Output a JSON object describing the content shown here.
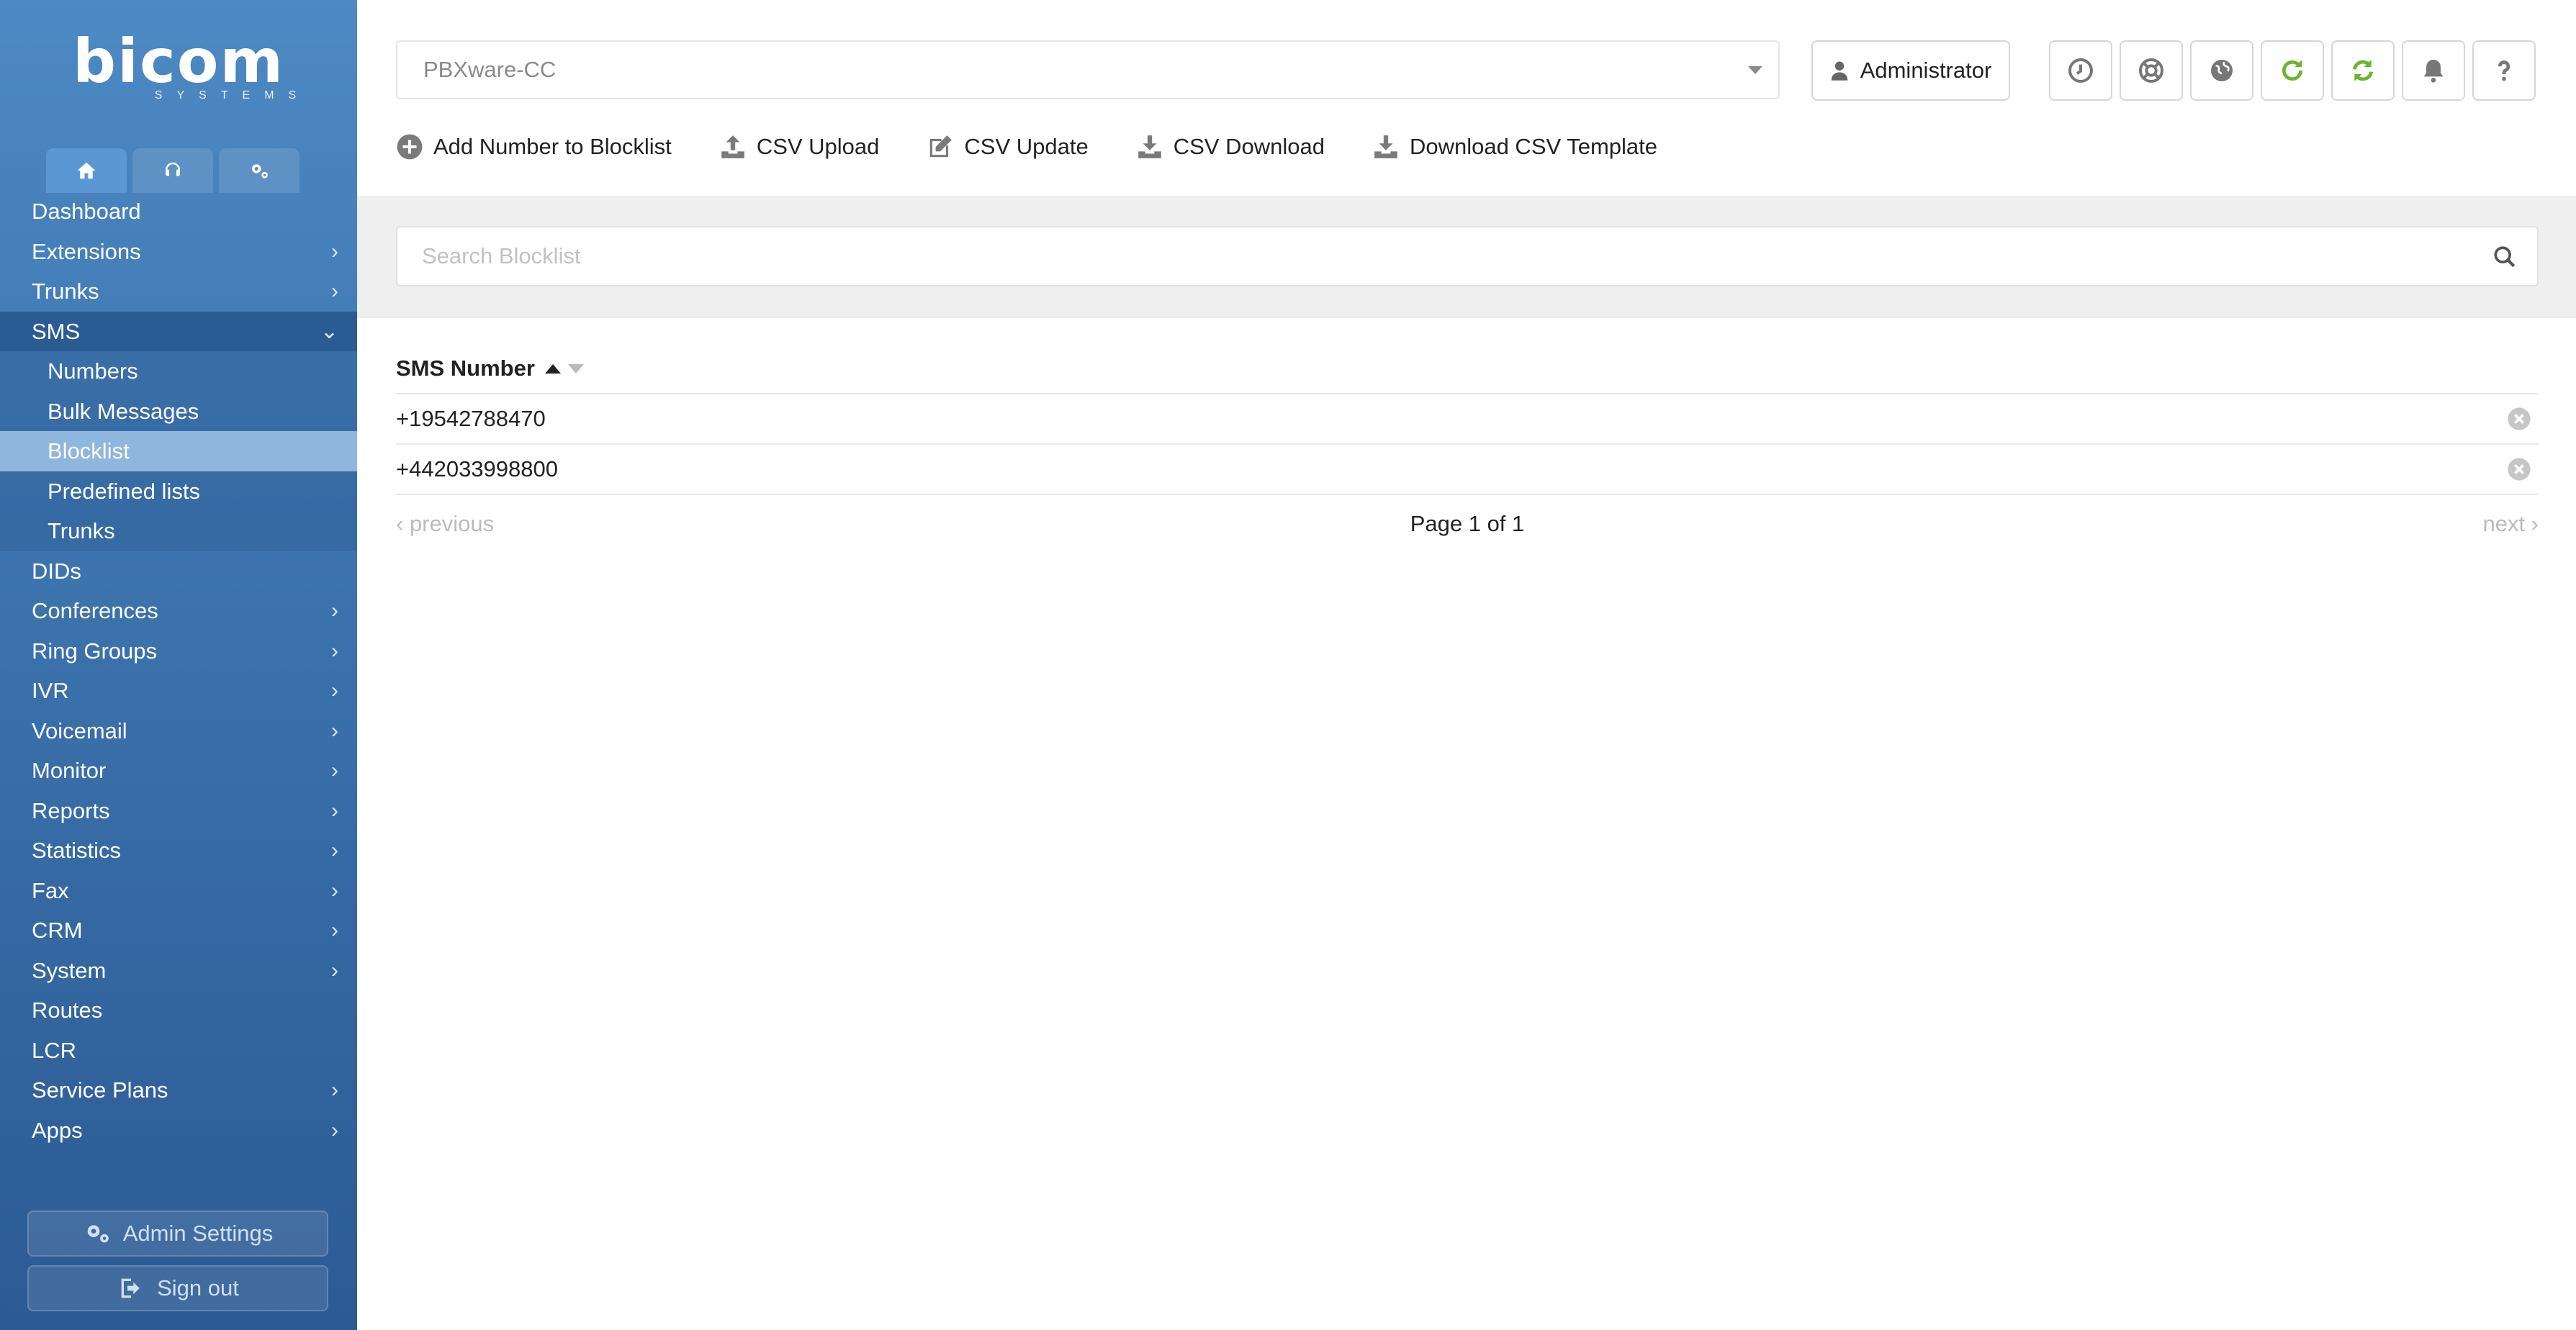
{
  "brand": {
    "logo_main": "bicom",
    "logo_sub": "SYSTEMS"
  },
  "sidebar": {
    "tabs": [
      {
        "icon": "home-icon"
      },
      {
        "icon": "headset-icon"
      },
      {
        "icon": "gears-icon"
      }
    ],
    "items": [
      {
        "label": "Dashboard",
        "chevron": ""
      },
      {
        "label": "Extensions",
        "chevron": "›"
      },
      {
        "label": "Trunks",
        "chevron": "›"
      },
      {
        "label": "SMS",
        "chevron": "⌄"
      },
      {
        "label": "Numbers"
      },
      {
        "label": "Bulk Messages"
      },
      {
        "label": "Blocklist"
      },
      {
        "label": "Predefined lists"
      },
      {
        "label": "Trunks"
      },
      {
        "label": "DIDs",
        "chevron": ""
      },
      {
        "label": "Conferences",
        "chevron": "›"
      },
      {
        "label": "Ring Groups",
        "chevron": "›"
      },
      {
        "label": "IVR",
        "chevron": "›"
      },
      {
        "label": "Voicemail",
        "chevron": "›"
      },
      {
        "label": "Monitor",
        "chevron": "›"
      },
      {
        "label": "Reports",
        "chevron": "›"
      },
      {
        "label": "Statistics",
        "chevron": "›"
      },
      {
        "label": "Fax",
        "chevron": "›"
      },
      {
        "label": "CRM",
        "chevron": "›"
      },
      {
        "label": "System",
        "chevron": "›"
      },
      {
        "label": "Routes",
        "chevron": ""
      },
      {
        "label": "LCR",
        "chevron": ""
      },
      {
        "label": "Service Plans",
        "chevron": "›"
      },
      {
        "label": "Apps",
        "chevron": "›"
      }
    ],
    "admin_settings": "Admin Settings",
    "sign_out": "Sign out"
  },
  "header": {
    "server_select": "PBXware-CC",
    "user_button": "Administrator",
    "icon_buttons": [
      "clock-icon",
      "lifebuoy-icon",
      "globe-icon",
      "refresh-icon",
      "sync-icon",
      "bell-icon",
      "help-icon"
    ]
  },
  "toolbar": {
    "add": "Add Number to Blocklist",
    "csv_upload": "CSV Upload",
    "csv_update": "CSV Update",
    "csv_download": "CSV Download",
    "download_template": "Download CSV Template"
  },
  "search": {
    "placeholder": "Search Blocklist"
  },
  "table": {
    "column": "SMS Number",
    "rows": [
      "+19542788470",
      "+442033998800"
    ]
  },
  "pager": {
    "previous": "previous",
    "page": "Page 1 of 1",
    "next": "next"
  },
  "colors": {
    "accent_green": "#6ab42f",
    "sidebar_blue": "#3c73ad",
    "active_sub": "#8fb6dd"
  }
}
